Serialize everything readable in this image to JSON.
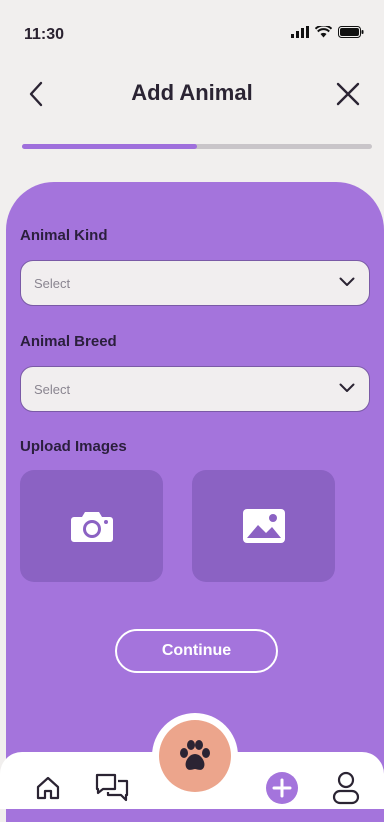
{
  "status_bar": {
    "time": "11:30"
  },
  "header": {
    "title": "Add Animal"
  },
  "progress": {
    "fraction": 0.5
  },
  "form": {
    "animal_kind": {
      "label": "Animal Kind",
      "placeholder": "Select"
    },
    "animal_breed": {
      "label": "Animal Breed",
      "placeholder": "Select"
    },
    "upload": {
      "label": "Upload Images"
    },
    "continue_label": "Continue"
  },
  "colors": {
    "accent": "#a474dc",
    "fab": "#eca58c",
    "text": "#2b2433"
  },
  "icons": [
    "back-arrow-icon",
    "close-icon",
    "chevron-down-icon",
    "camera-icon",
    "image-icon",
    "home-icon",
    "chat-icon",
    "paw-icon",
    "plus-icon",
    "profile-icon"
  ]
}
